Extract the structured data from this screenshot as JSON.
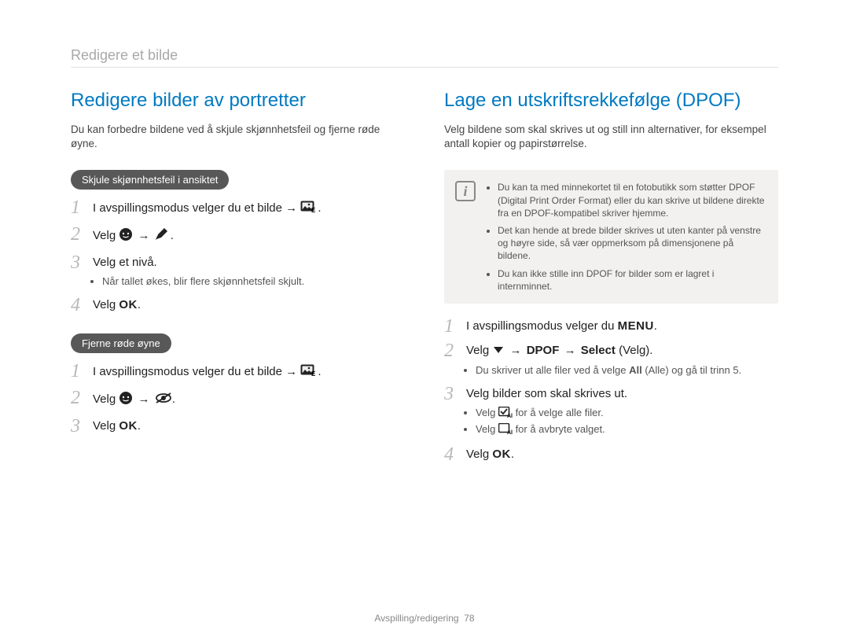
{
  "breadcrumb": "Redigere et bilde",
  "left": {
    "heading": "Redigere bilder av portretter",
    "intro": "Du kan forbedre bildene ved å skjule skjønnhetsfeil og fjerne røde øyne.",
    "section1": {
      "chip": "Skjule skjønnhetsfeil i ansiktet",
      "step1": "I avspillingsmodus velger du et bilde →",
      "step2": "Velg",
      "step3": "Velg et nivå.",
      "step3_bullet": "Når tallet økes, blir flere skjønnhetsfeil skjult.",
      "step4": "Velg"
    },
    "section2": {
      "chip": "Fjerne røde øyne",
      "step1": "I avspillingsmodus velger du et bilde →",
      "step2": "Velg",
      "step3": "Velg"
    }
  },
  "right": {
    "heading": "Lage en utskriftsrekkefølge (DPOF)",
    "intro": "Velg bildene som skal skrives ut og still inn alternativer, for eksempel antall kopier og papirstørrelse.",
    "notes": {
      "n1": "Du kan ta med minnekortet til en fotobutikk som støtter DPOF (Digital Print Order Format) eller du kan skrive ut bildene direkte fra en DPOF-kompatibel skriver hjemme.",
      "n2": "Det kan hende at brede bilder skrives ut uten kanter på venstre og høyre side, så vær oppmerksom på dimensjonene på bildene.",
      "n3": "Du kan ikke stille inn DPOF for bilder som er lagret i internminnet."
    },
    "step1": "I avspillingsmodus velger du",
    "step2_a": "Velg",
    "step2_b": "DPOF",
    "step2_c": "Select",
    "step2_d": " (Velg).",
    "step2_bullet_a": "Du skriver ut alle filer ved å velge ",
    "step2_bullet_b": "All",
    "step2_bullet_c": " (Alle) og gå til trinn 5.",
    "step3": "Velg bilder som skal skrives ut.",
    "step3_bullet1_a": "Velg",
    "step3_bullet1_b": "for å velge alle filer.",
    "step3_bullet2_a": "Velg",
    "step3_bullet2_b": "for å avbryte valget.",
    "step4": "Velg"
  },
  "footer_section": "Avspilling/redigering",
  "footer_page": "78",
  "glyphs": {
    "arrow": "→",
    "menu": "MENU",
    "ok": "OK"
  }
}
